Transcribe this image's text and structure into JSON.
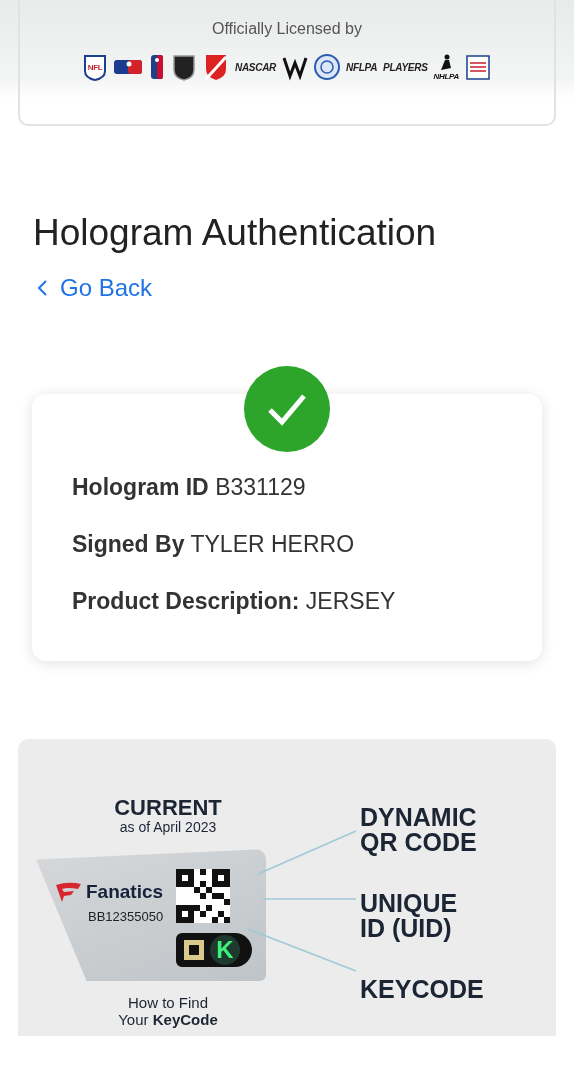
{
  "banner": {
    "title": "Officially Licensed by",
    "logos": [
      {
        "kind": "shield",
        "label": "NFL"
      },
      {
        "kind": "batter"
      },
      {
        "kind": "player"
      },
      {
        "kind": "dark-shield"
      },
      {
        "kind": "crest"
      },
      {
        "kind": "wordmark",
        "label": "NASCAR"
      },
      {
        "kind": "ww"
      },
      {
        "kind": "seal"
      },
      {
        "kind": "wordmark",
        "label": "NFLPA"
      },
      {
        "kind": "wordmark",
        "label": "PLAYERS"
      },
      {
        "kind": "skater",
        "label": "NHLPA"
      },
      {
        "kind": "hall"
      }
    ]
  },
  "page": {
    "title": "Hologram Authentication",
    "back_link": "Go Back"
  },
  "result": {
    "verified": true,
    "fields": [
      {
        "label": "Hologram ID",
        "value": "B331129"
      },
      {
        "label": "Signed By",
        "value": "TYLER HERRO"
      },
      {
        "label": "Product Description:",
        "value": "JERSEY"
      }
    ]
  },
  "infographic": {
    "heading": "CURRENT",
    "subheading": "as of April 2023",
    "sticker": {
      "brand": "Fanatics",
      "serial": "BB12355050",
      "key_letter": "K"
    },
    "callouts": [
      "DYNAMIC\nQR CODE",
      "UNIQUE\nID (UID)",
      "KEYCODE"
    ],
    "caption": "How to Find\nYour **KeyCode**"
  }
}
